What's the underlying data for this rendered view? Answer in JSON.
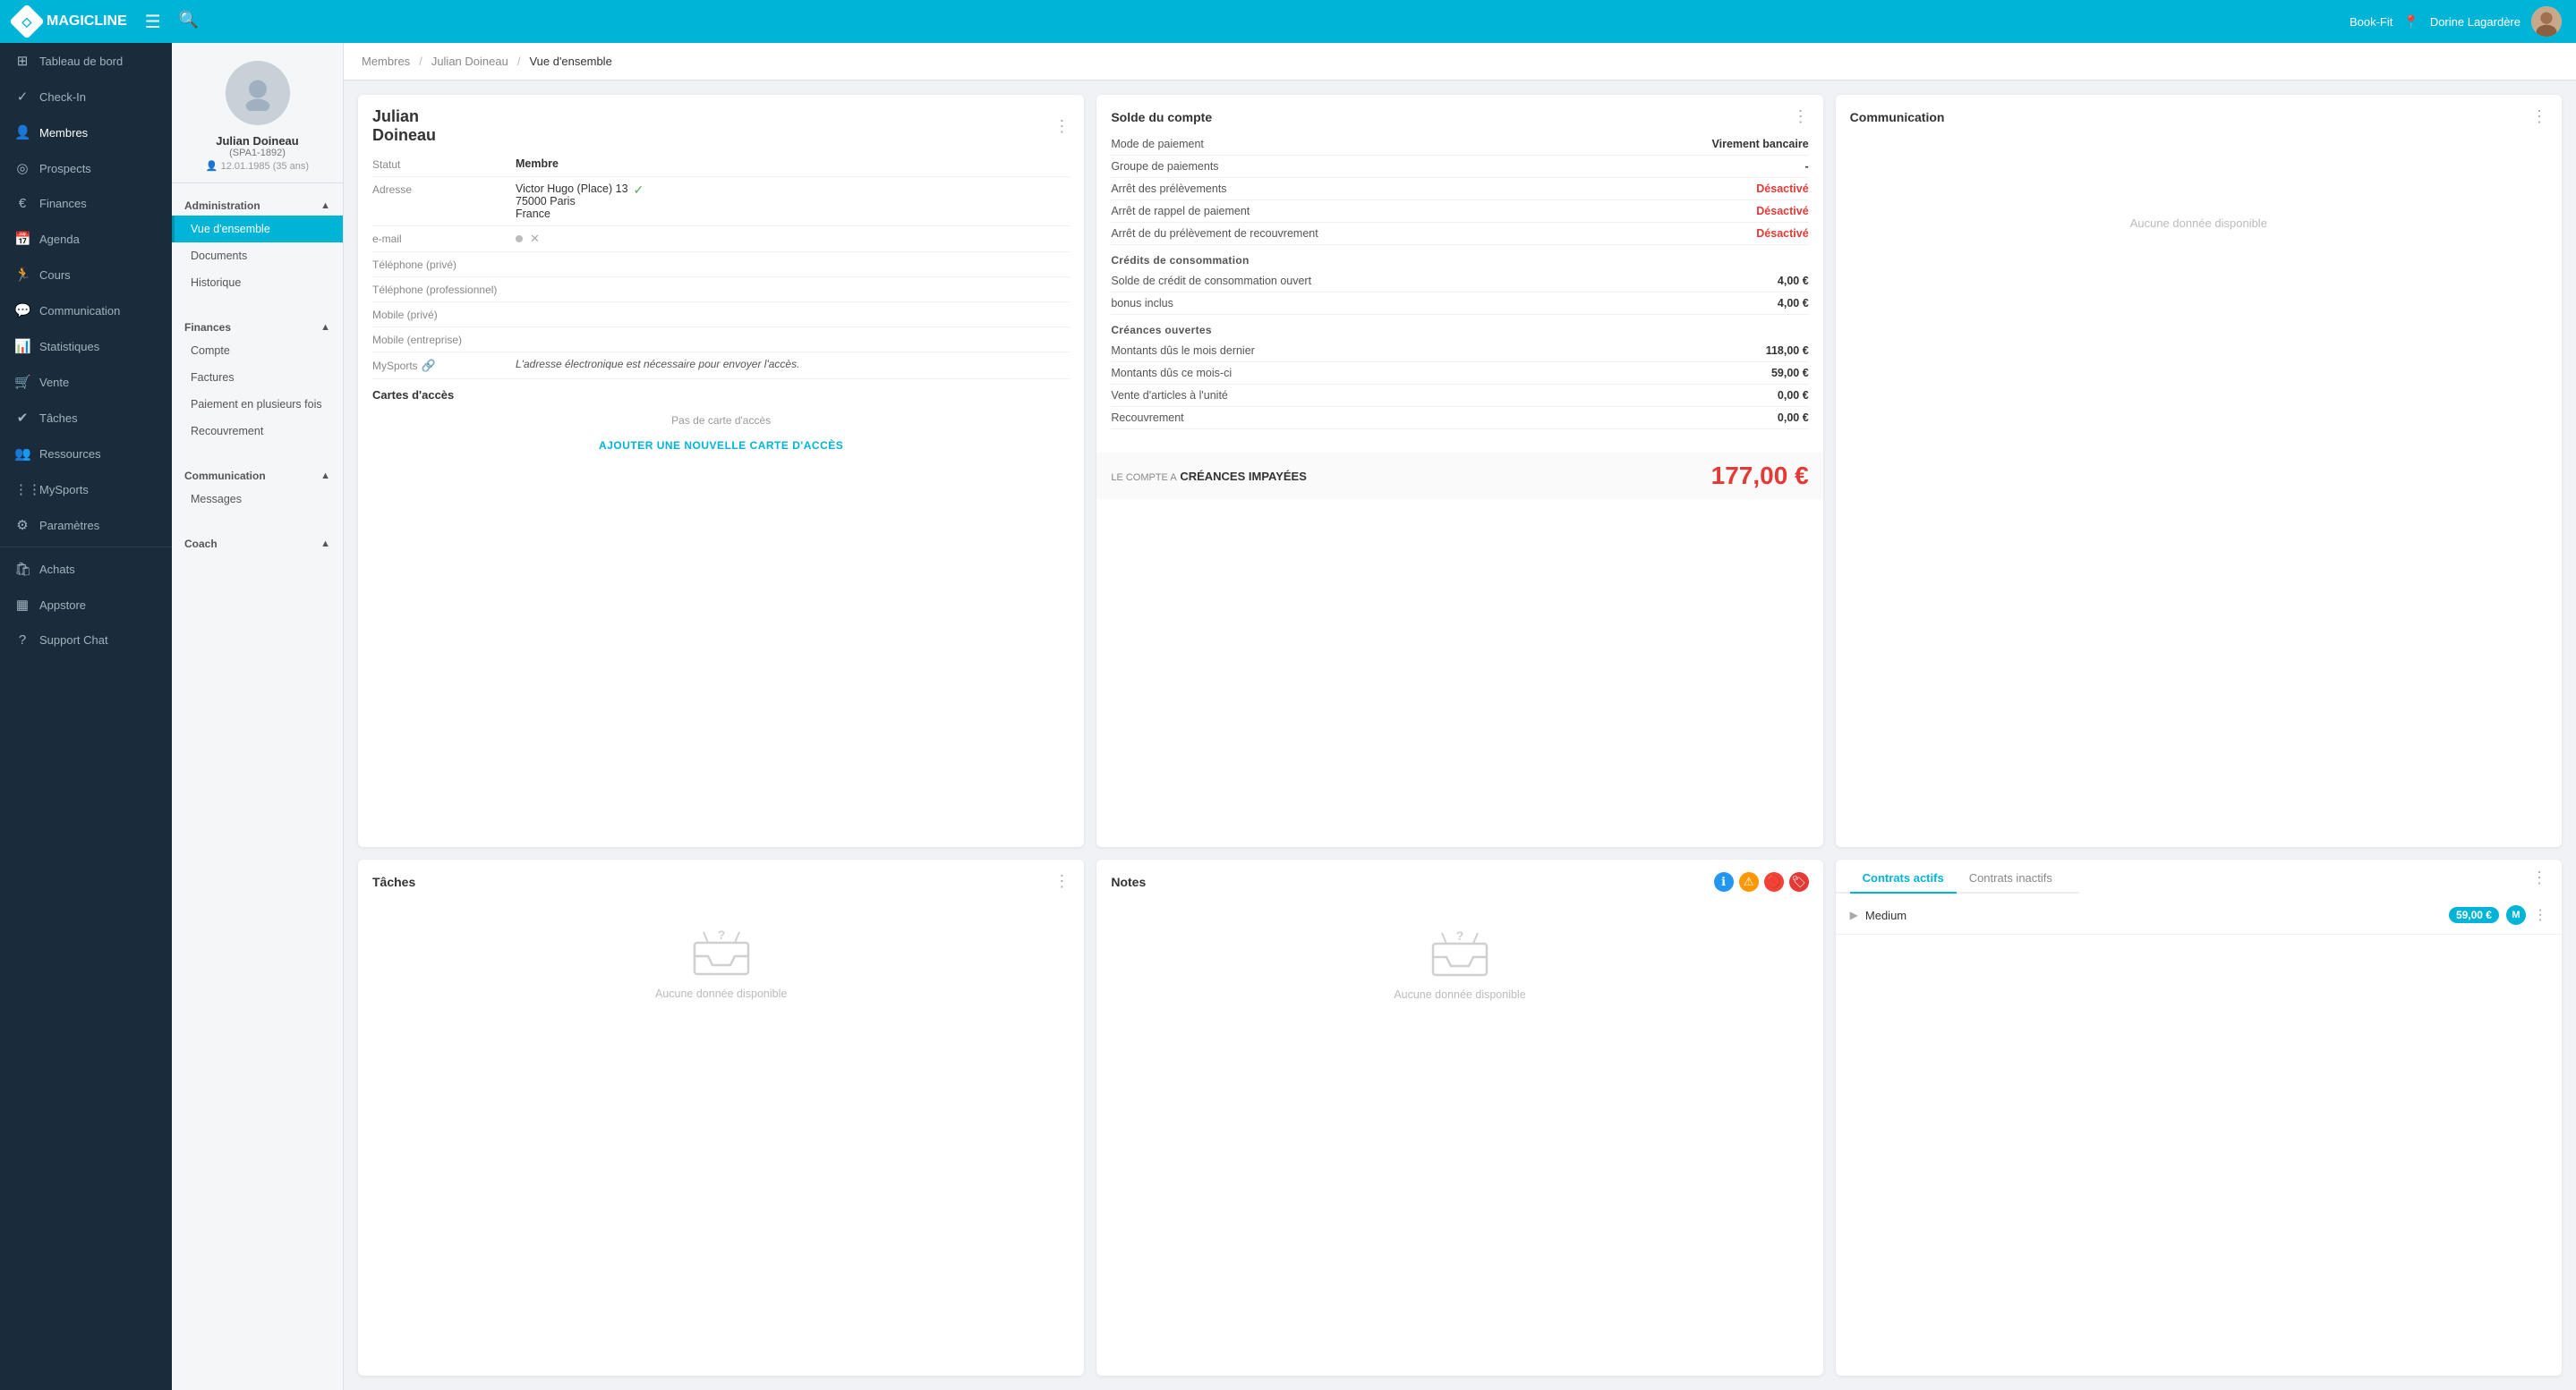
{
  "topbar": {
    "logo_text": "MAGICLINE",
    "menu_icon": "≡",
    "search_icon": "🔍",
    "location": "Book-Fit",
    "user": "Dorine Lagardère"
  },
  "sidebar": {
    "items": [
      {
        "id": "tableau-de-bord",
        "label": "Tableau de bord",
        "icon": "⊞"
      },
      {
        "id": "check-in",
        "label": "Check-In",
        "icon": "✓"
      },
      {
        "id": "membres",
        "label": "Membres",
        "icon": "👤",
        "active": true
      },
      {
        "id": "prospects",
        "label": "Prospects",
        "icon": "◎"
      },
      {
        "id": "finances",
        "label": "Finances",
        "icon": "€"
      },
      {
        "id": "agenda",
        "label": "Agenda",
        "icon": "📅"
      },
      {
        "id": "cours",
        "label": "Cours",
        "icon": "🏃"
      },
      {
        "id": "communication",
        "label": "Communication",
        "icon": "💬"
      },
      {
        "id": "statistiques",
        "label": "Statistiques",
        "icon": "📊"
      },
      {
        "id": "vente",
        "label": "Vente",
        "icon": "🛒"
      },
      {
        "id": "taches",
        "label": "Tâches",
        "icon": "✔"
      },
      {
        "id": "ressources",
        "label": "Ressources",
        "icon": "👥"
      },
      {
        "id": "mysports",
        "label": "MySports",
        "icon": "⋮⋮"
      },
      {
        "id": "parametres",
        "label": "Paramètres",
        "icon": "⚙"
      },
      {
        "id": "achats",
        "label": "Achats",
        "icon": "🛍"
      },
      {
        "id": "appstore",
        "label": "Appstore",
        "icon": "▦"
      },
      {
        "id": "support-chat",
        "label": "Support Chat",
        "icon": "?"
      }
    ]
  },
  "subsidebar": {
    "profile": {
      "name": "Julian Doineau",
      "id": "(SPA1-1892)",
      "dob": "12.01.1985 (35 ans)"
    },
    "sections": [
      {
        "id": "administration",
        "label": "Administration",
        "expanded": true,
        "items": [
          {
            "id": "vue-ensemble",
            "label": "Vue d'ensemble",
            "active": true
          },
          {
            "id": "documents",
            "label": "Documents"
          },
          {
            "id": "historique",
            "label": "Historique"
          }
        ]
      },
      {
        "id": "finances",
        "label": "Finances",
        "expanded": true,
        "items": [
          {
            "id": "compte",
            "label": "Compte"
          },
          {
            "id": "factures",
            "label": "Factures"
          },
          {
            "id": "paiement-plusieurs",
            "label": "Paiement en plusieurs fois"
          },
          {
            "id": "recouvrement",
            "label": "Recouvrement"
          }
        ]
      },
      {
        "id": "communication",
        "label": "Communication",
        "expanded": true,
        "items": [
          {
            "id": "messages",
            "label": "Messages"
          }
        ]
      },
      {
        "id": "coach",
        "label": "Coach",
        "expanded": true,
        "items": []
      }
    ]
  },
  "breadcrumb": {
    "items": [
      {
        "label": "Membres",
        "current": false
      },
      {
        "label": "Julian Doineau",
        "current": false
      },
      {
        "label": "Vue d'ensemble",
        "current": true
      }
    ]
  },
  "personal_card": {
    "title": "Julian Doineau",
    "first_name": "Julian",
    "last_name": "Doineau",
    "fields": [
      {
        "label": "Statut",
        "value": "Membre",
        "bold": true
      },
      {
        "label": "Adresse",
        "value": "Victor Hugo (Place) 13\n75000 Paris\nFrance",
        "has_check": true
      },
      {
        "label": "e-mail",
        "value": "",
        "is_email": true
      },
      {
        "label": "Téléphone (privé)",
        "value": ""
      },
      {
        "label": "Téléphone (professionnel)",
        "value": ""
      },
      {
        "label": "Mobile (privé)",
        "value": ""
      },
      {
        "label": "Mobile (entreprise)",
        "value": ""
      },
      {
        "label": "MySports",
        "value": "L'adresse électronique est nécessaire pour envoyer l'accès.",
        "is_mysports": true
      }
    ],
    "acces": {
      "title": "Cartes d'accès",
      "no_card_text": "Pas de carte d'accès",
      "add_btn": "AJOUTER UNE NOUVELLE CARTE D'ACCÈS"
    }
  },
  "solde_card": {
    "title": "Solde du compte",
    "payment_mode_label": "Mode de paiement",
    "payment_mode_value": "Virement bancaire",
    "payment_group_label": "Groupe de paiements",
    "payment_group_value": "-",
    "arret_prelevement_label": "Arrêt des prélèvements",
    "arret_prelevement_value": "Désactivé",
    "arret_rappel_label": "Arrêt de rappel de paiement",
    "arret_rappel_value": "Désactivé",
    "arret_recouvrement_label": "Arrêt de du prélèvement de recouvrement",
    "arret_recouvrement_value": "Désactivé",
    "credits_title": "Crédits de consommation",
    "solde_credit_label": "Solde de crédit de consommation ouvert",
    "solde_credit_value": "4,00 €",
    "bonus_label": "bonus inclus",
    "bonus_value": "4,00 €",
    "creances_title": "Créances ouvertes",
    "montants_mois_dernier_label": "Montants dûs le mois dernier",
    "montants_mois_dernier_value": "118,00 €",
    "montants_mois_ci_label": "Montants dûs ce mois-ci",
    "montants_mois_ci_value": "59,00 €",
    "vente_articles_label": "Vente d'articles à l'unité",
    "vente_articles_value": "0,00 €",
    "recouvrement_label": "Recouvrement",
    "recouvrement_value": "0,00 €",
    "total_label_top": "LE COMPTE A",
    "total_label": "CRÉANCES IMPAYÉES",
    "total_value": "177,00 €"
  },
  "communication_card": {
    "title": "Communication",
    "empty_text": "Aucune donnée disponible"
  },
  "taches_card": {
    "title": "Tâches",
    "empty_text": "Aucune donnée disponible"
  },
  "notes_card": {
    "title": "Notes",
    "empty_text": "Aucune donnée disponible"
  },
  "contrats_card": {
    "tab_active": "Contrats actifs",
    "tab_inactive": "Contrats inactifs",
    "items": [
      {
        "name": "Medium",
        "price": "59,00 €",
        "badge": "M"
      }
    ]
  }
}
